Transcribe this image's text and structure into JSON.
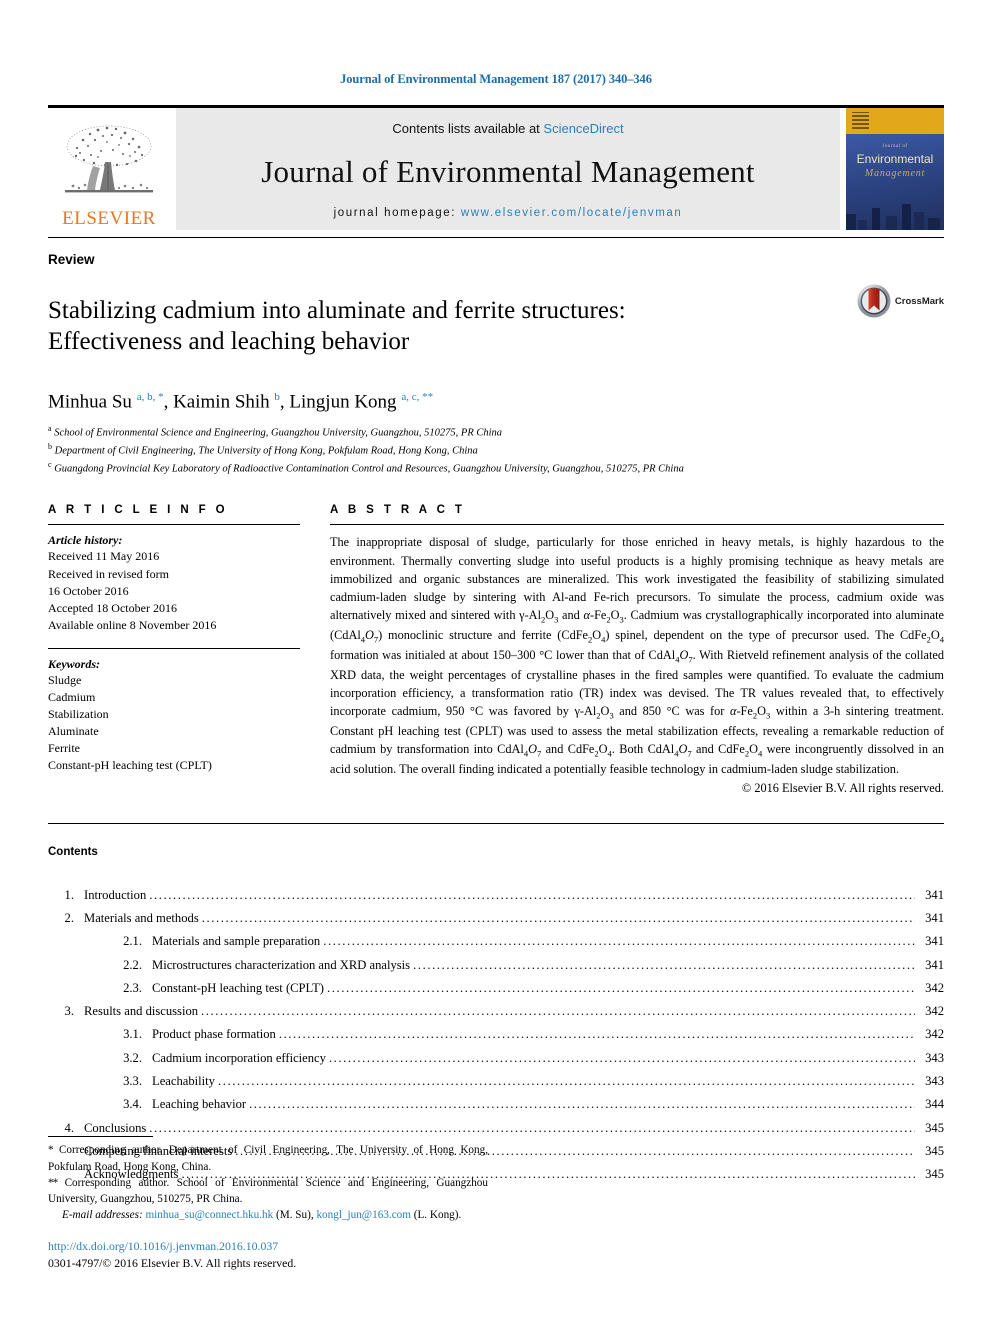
{
  "running_head": "Journal of Environmental Management 187 (2017) 340–346",
  "masthead": {
    "contents_prefix": "Contents lists available at ",
    "sciencedirect": "ScienceDirect",
    "journal_name": "Journal of Environmental Management",
    "homepage_prefix": "journal homepage: ",
    "homepage_url": "www.elsevier.com/locate/jenvman",
    "publisher_wordmark": "ELSEVIER",
    "publisher_color": "#E87722",
    "link_color": "#2b7fb8",
    "cover": {
      "journal_of": "Journal of",
      "title_line1": "Environmental",
      "title_line2": "Management"
    }
  },
  "article": {
    "type": "Review",
    "title_line1": "Stabilizing cadmium into aluminate and ferrite structures:",
    "title_line2": "Effectiveness and leaching behavior",
    "crossmark_label": "CrossMark",
    "authors_html": "Minhua Su <sup>a, b, *</sup>, Kaimin Shih <sup>b</sup>, Lingjun Kong <sup>a, c, **</sup>",
    "affiliations": [
      {
        "marker": "a",
        "text": "School of Environmental Science and Engineering, Guangzhou University, Guangzhou, 510275, PR China"
      },
      {
        "marker": "b",
        "text": "Department of Civil Engineering, The University of Hong Kong, Pokfulam Road, Hong Kong, China"
      },
      {
        "marker": "c",
        "text": "Guangdong Provincial Key Laboratory of Radioactive Contamination Control and Resources, Guangzhou University, Guangzhou, 510275, PR China"
      }
    ]
  },
  "article_info": {
    "heading": "A R T I C L E   I N F O",
    "history_title": "Article history:",
    "history_lines": [
      "Received 11 May 2016",
      "Received in revised form",
      "16 October 2016",
      "Accepted 18 October 2016",
      "Available online 8 November 2016"
    ],
    "keywords_title": "Keywords:",
    "keywords": [
      "Sludge",
      "Cadmium",
      "Stabilization",
      "Aluminate",
      "Ferrite",
      "Constant-pH leaching test (CPLT)"
    ]
  },
  "abstract": {
    "heading": "A B S T R A C T",
    "body_html": "The inappropriate disposal of sludge, particularly for those enriched in heavy metals, is highly hazardous to the environment. Thermally converting sludge into useful products is a highly promising technique as heavy metals are immobilized and organic substances are mineralized. This work investigated the feasibility of stabilizing simulated cadmium-laden sludge by sintering with Al-and Fe-rich precursors. To simulate the process, cadmium oxide was alternatively mixed and sintered with γ-Al<sub>2</sub>O<sub>3</sub> and <i>α</i>-Fe<sub>2</sub>O<sub>3</sub>. Cadmium was crystallographically incorporated into aluminate (CdAl<sub>4</sub><i>O</i><sub>7</sub>) monoclinic structure and ferrite (CdFe<sub>2</sub>O<sub>4</sub>) spinel, dependent on the type of precursor used. The CdFe<sub>2</sub>O<sub>4</sub> formation was initialed at about 150–300 °C lower than that of CdAl<sub>4</sub><i>O</i><sub>7</sub>. With Rietveld refinement analysis of the collated XRD data, the weight percentages of crystalline phases in the fired samples were quantified. To evaluate the cadmium incorporation efficiency, a transformation ratio (TR) index was devised. The TR values revealed that, to effectively incorporate cadmium, 950 °C was favored by γ-Al<sub>2</sub>O<sub>3</sub> and 850 °C was for <i>α</i>-Fe<sub>2</sub>O<sub>3</sub> within a 3-h sintering treatment. Constant pH leaching test (CPLT) was used to assess the metal stabilization effects, revealing a remarkable reduction of cadmium by transformation into CdAl<sub>4</sub><i>O</i><sub>7</sub> and CdFe<sub>2</sub>O<sub>4</sub>. Both CdAl<sub>4</sub><i>O</i><sub>7</sub> and CdFe<sub>2</sub>O<sub>4</sub> were incongruently dissolved in an acid solution. The overall finding indicated a potentially feasible technology in cadmium-laden sludge stabilization.",
    "copyright": "© 2016 Elsevier B.V. All rights reserved."
  },
  "contents": {
    "heading": "Contents",
    "items": [
      {
        "num": "1.",
        "label": "Introduction",
        "page": "341",
        "level": 0
      },
      {
        "num": "2.",
        "label": "Materials and methods",
        "page": "341",
        "level": 0
      },
      {
        "num": "2.1.",
        "label": "Materials and sample preparation",
        "page": "341",
        "level": 1
      },
      {
        "num": "2.2.",
        "label": "Microstructures characterization and XRD analysis",
        "page": "341",
        "level": 1
      },
      {
        "num": "2.3.",
        "label": "Constant-pH leaching test (CPLT)",
        "page": "342",
        "level": 1
      },
      {
        "num": "3.",
        "label": "Results and discussion",
        "page": "342",
        "level": 0
      },
      {
        "num": "3.1.",
        "label": "Product phase formation",
        "page": "342",
        "level": 1
      },
      {
        "num": "3.2.",
        "label": "Cadmium incorporation efficiency",
        "page": "343",
        "level": 1
      },
      {
        "num": "3.3.",
        "label": "Leachability",
        "page": "343",
        "level": 1
      },
      {
        "num": "3.4.",
        "label": "Leaching behavior",
        "page": "344",
        "level": 1
      },
      {
        "num": "4.",
        "label": "Conclusions",
        "page": "345",
        "level": 0
      },
      {
        "num": "",
        "label": "Competing financial interests",
        "page": "345",
        "level": 0
      },
      {
        "num": "",
        "label": "Acknowledgments",
        "page": "345",
        "level": 0
      }
    ]
  },
  "footnotes": {
    "corresponding_1_html": "<span class=\"star\">*</span> Corresponding author. Department of Civil Engineering, The University of Hong Kong, Pokfulam Road, Hong Kong, China.",
    "corresponding_2_html": "<span class=\"star\">**</span> Corresponding author. School of Environmental Science and Engineering, Guangzhou University, Guangzhou, 510275, PR China.",
    "emails_html": "<em>E-mail addresses:</em> <a href=\"#\">minhua_su@connect.hku.hk</a> (M. Su), <a href=\"#\">kongl_jun@163.com</a> (L. Kong).",
    "doi": "http://dx.doi.org/10.1016/j.jenvman.2016.10.037",
    "issn_line": "0301-4797/© 2016 Elsevier B.V. All rights reserved."
  }
}
